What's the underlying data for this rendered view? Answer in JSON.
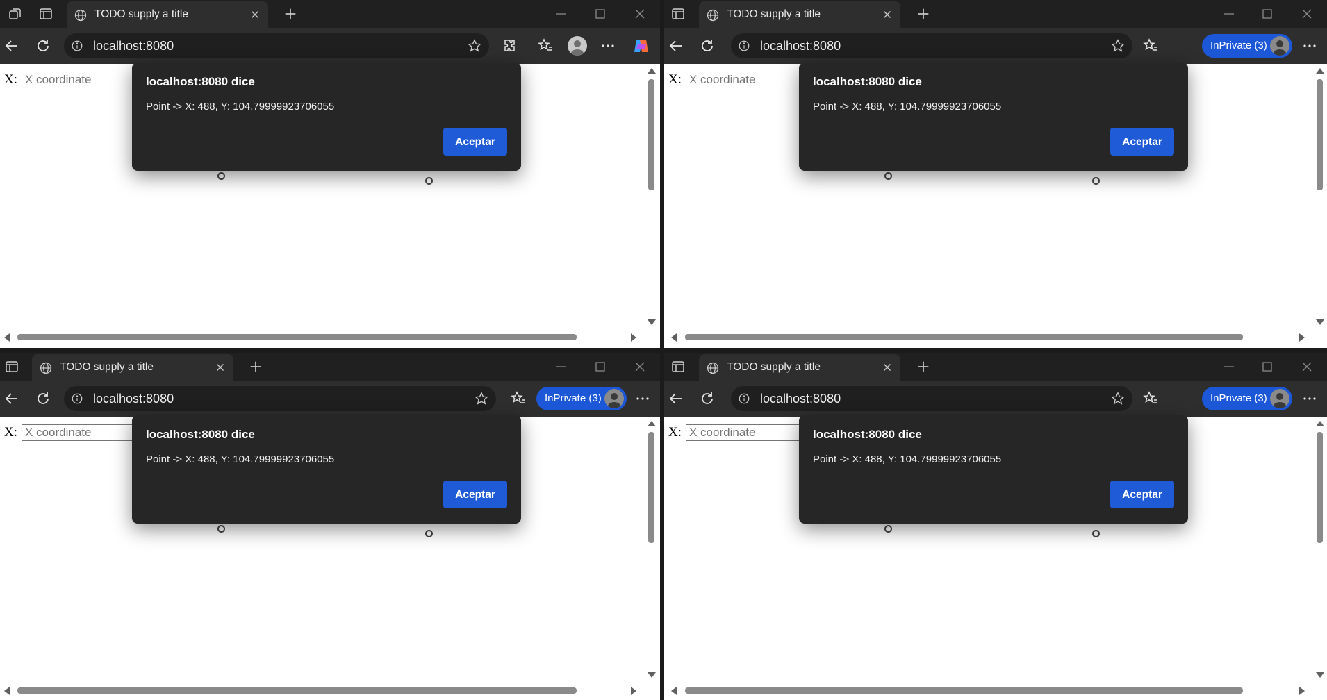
{
  "windows": [
    {
      "id": "win-0",
      "tab_title": "TODO supply a title",
      "url": "localhost:8080",
      "profile": "profile-avatar",
      "inprivate_label": "",
      "x_label": "X:",
      "x_placeholder": "X coordinate",
      "dialog": {
        "title": "localhost:8080 dice",
        "message": "Point -> X: 488, Y: 104.79999923706055",
        "button": "Aceptar"
      }
    },
    {
      "id": "win-1",
      "tab_title": "TODO supply a title",
      "url": "localhost:8080",
      "profile": "inprivate",
      "inprivate_label": "InPrivate (3)",
      "x_label": "X:",
      "x_placeholder": "X coordinate",
      "dialog": {
        "title": "localhost:8080 dice",
        "message": "Point -> X: 488, Y: 104.79999923706055",
        "button": "Aceptar"
      }
    },
    {
      "id": "win-2",
      "tab_title": "TODO supply a title",
      "url": "localhost:8080",
      "profile": "inprivate",
      "inprivate_label": "InPrivate (3)",
      "x_label": "X:",
      "x_placeholder": "X coordinate",
      "dialog": {
        "title": "localhost:8080 dice",
        "message": "Point -> X: 488, Y: 104.79999923706055",
        "button": "Aceptar"
      }
    },
    {
      "id": "win-3",
      "tab_title": "TODO supply a title",
      "url": "localhost:8080",
      "profile": "inprivate",
      "inprivate_label": "InPrivate (3)",
      "x_label": "X:",
      "x_placeholder": "X coordinate",
      "dialog": {
        "title": "localhost:8080 dice",
        "message": "Point -> X: 488, Y: 104.79999923706055",
        "button": "Aceptar"
      }
    }
  ],
  "icons": {
    "workspaces": "workspaces-icon",
    "tab_actions": "tab-actions-icon",
    "globe": "globe-icon",
    "close": "close-icon",
    "new_tab": "plus-icon",
    "back": "back-arrow-icon",
    "refresh": "refresh-icon",
    "site_info": "info-icon",
    "favorite": "star-icon",
    "extensions": "puzzle-icon",
    "favorites": "favorites-icon",
    "more": "more-icon",
    "copilot": "copilot-icon"
  },
  "colors": {
    "chrome_dark": "#202020",
    "toolbar": "#2e2e2e",
    "accent_blue": "#1f5bd6",
    "dialog_bg": "#262626",
    "page_bg": "#ffffff"
  }
}
